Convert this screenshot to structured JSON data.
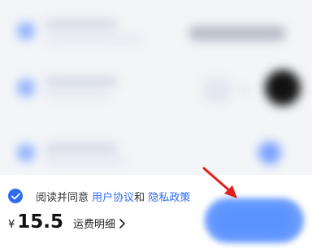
{
  "agreement": {
    "prefix": "阅读并同意",
    "user_agreement": "用户协议",
    "and": "和",
    "privacy_policy": "隐私政策"
  },
  "price": {
    "currency": "¥",
    "amount": "15.5"
  },
  "shipping_detail": {
    "label": "运费明细"
  },
  "colors": {
    "accent": "#2f6bf3",
    "arrow": "#e0201d",
    "submit": "#5b92ff"
  },
  "icons": [
    "checkmark-icon",
    "chevron-right-icon",
    "annotation-arrow-icon"
  ]
}
